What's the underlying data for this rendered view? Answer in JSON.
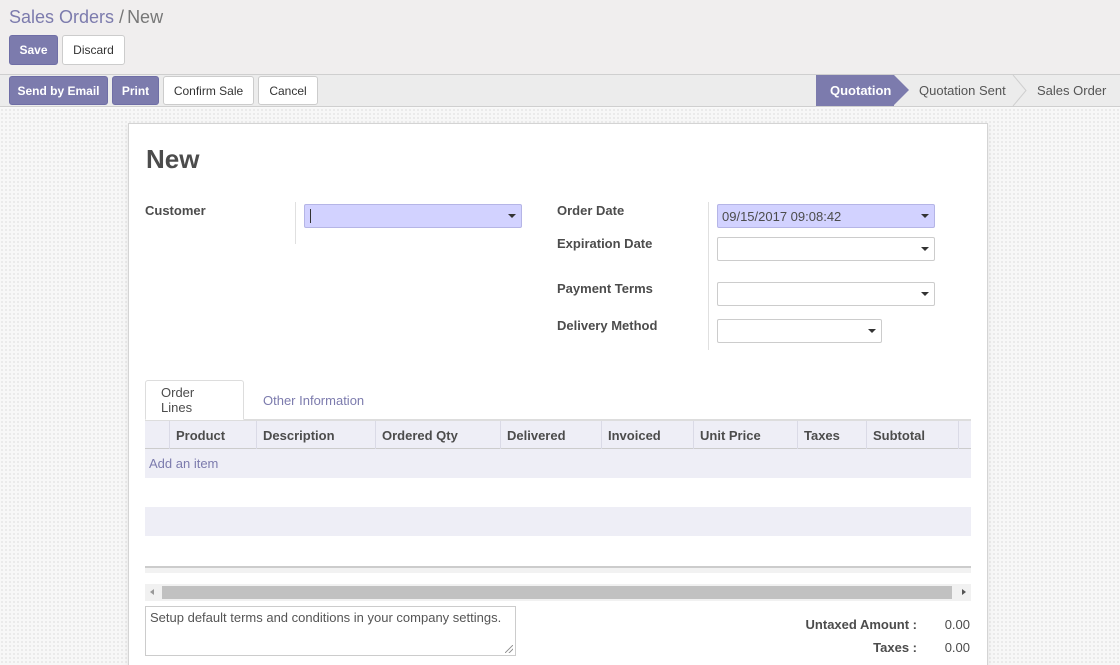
{
  "breadcrumb": {
    "parent": "Sales Orders",
    "separator": "/",
    "current": "New"
  },
  "control_buttons": {
    "save": "Save",
    "discard": "Discard"
  },
  "status_buttons": {
    "send_email": "Send by Email",
    "print": "Print",
    "confirm": "Confirm Sale",
    "cancel": "Cancel"
  },
  "stages": {
    "quotation": "Quotation",
    "sent": "Quotation Sent",
    "order": "Sales Order",
    "active": "Quotation"
  },
  "form": {
    "title": "New",
    "customer_label": "Customer",
    "customer_value": "",
    "order_date_label": "Order Date",
    "order_date_value": "09/15/2017 09:08:42",
    "expiration_label": "Expiration Date",
    "expiration_value": "",
    "payment_terms_label": "Payment Terms",
    "payment_terms_value": "",
    "delivery_label": "Delivery Method",
    "delivery_value": ""
  },
  "tabs": {
    "order_lines": "Order Lines",
    "other_info": "Other Information",
    "active": "Order Lines"
  },
  "table": {
    "columns": [
      "Product",
      "Description",
      "Ordered Qty",
      "Delivered",
      "Invoiced",
      "Unit Price",
      "Taxes",
      "Subtotal"
    ],
    "add_item": "Add an item"
  },
  "note": {
    "placeholder": "Setup default terms and conditions in your company settings."
  },
  "totals": {
    "untaxed_label": "Untaxed Amount :",
    "untaxed_value": "0.00",
    "taxes_label": "Taxes :",
    "taxes_value": "0.00"
  },
  "colors": {
    "brand": "#7c7bad",
    "focus_field": "#d2d2ff",
    "row_stripe": "#eeeef6"
  }
}
